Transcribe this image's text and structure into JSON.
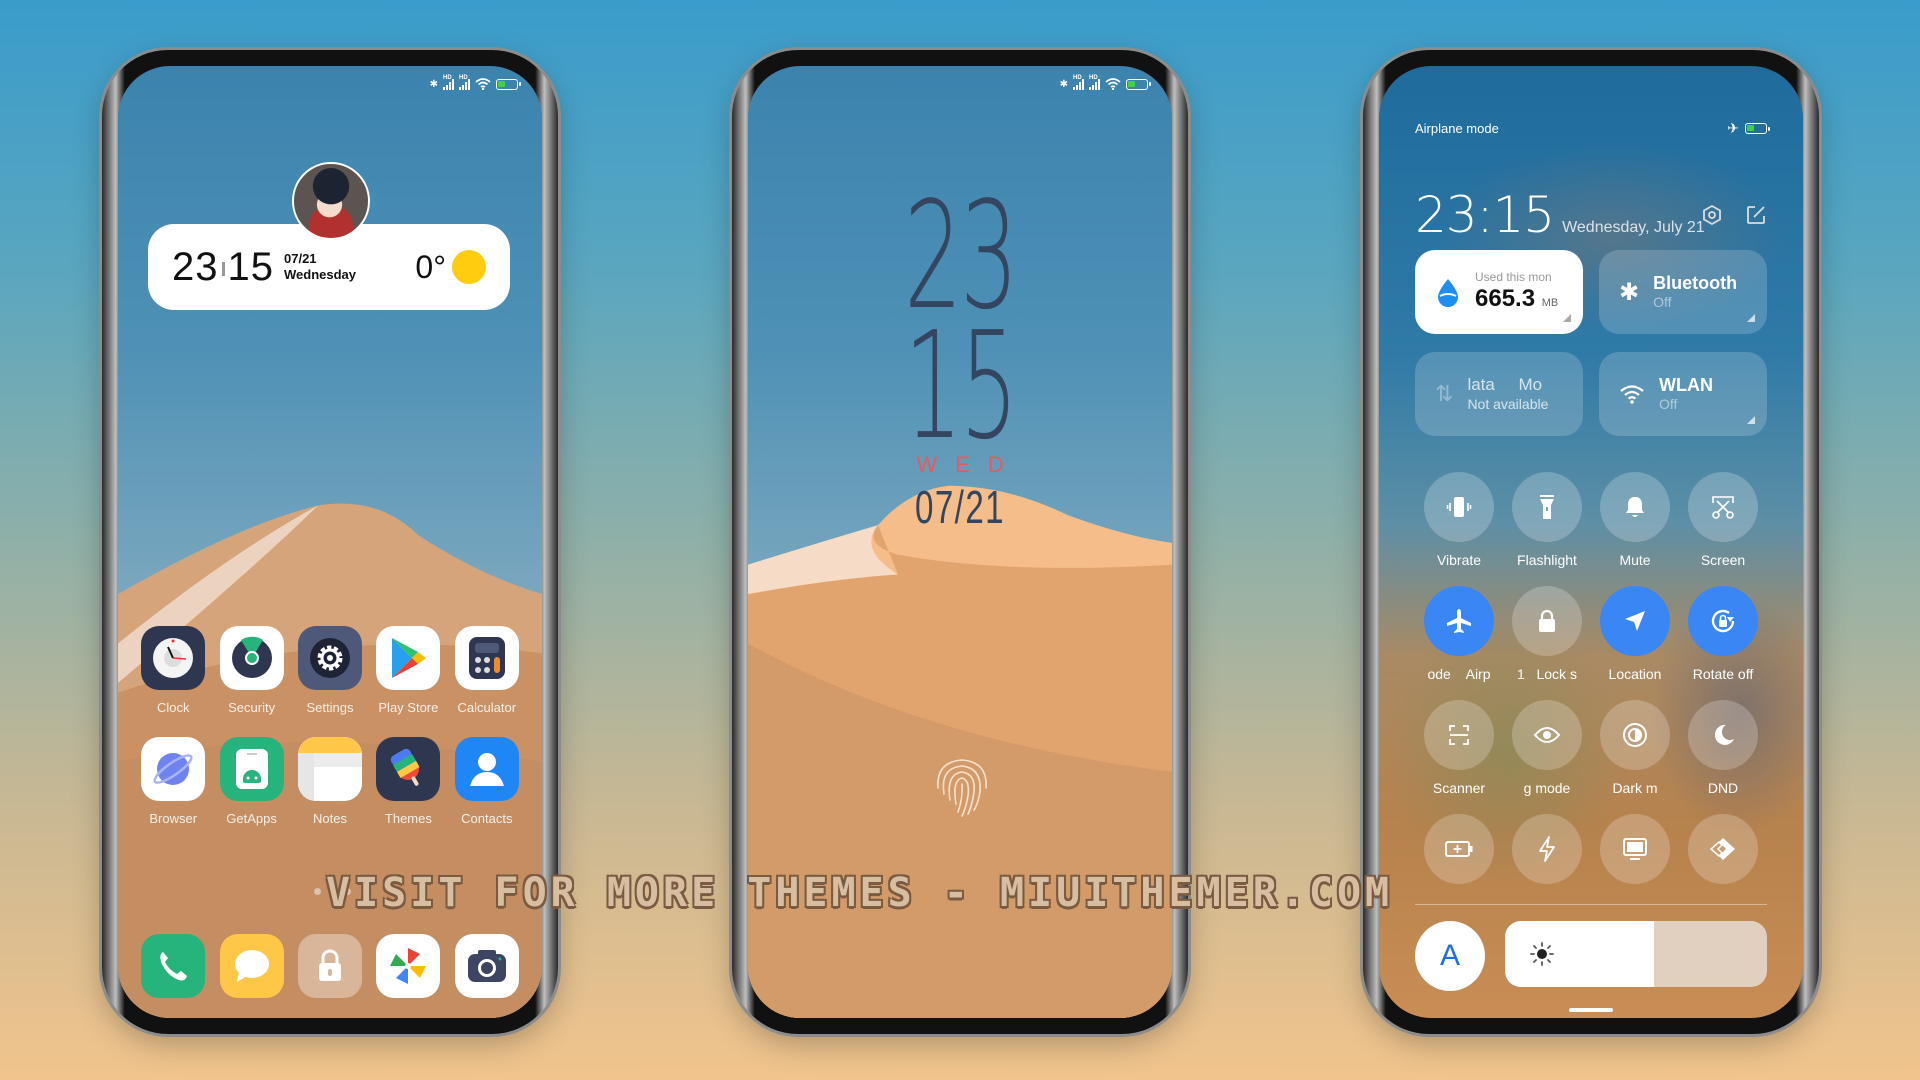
{
  "left_phone": {
    "status_icons": [
      "bluetooth-icon",
      "signal-hd-icon",
      "signal-hd-icon",
      "wifi-icon",
      "battery-charging-icon"
    ],
    "widget": {
      "hour": "23",
      "minute": "15",
      "date": "07/21",
      "weekday": "Wednesday",
      "temperature": "0°",
      "weather": "sunny"
    },
    "apps": [
      {
        "label": "Clock",
        "icon": "clock-icon",
        "bg": "#2e3650"
      },
      {
        "label": "Security",
        "icon": "security-radar-icon",
        "bg": "#ffffff"
      },
      {
        "label": "Settings",
        "icon": "gear-icon",
        "bg": "#4e5878"
      },
      {
        "label": "Play Store",
        "icon": "play-store-icon",
        "bg": "#ffffff"
      },
      {
        "label": "Calculator",
        "icon": "calculator-icon",
        "bg": "#ffffff"
      },
      {
        "label": "Browser",
        "icon": "planet-icon",
        "bg": "#ffffff"
      },
      {
        "label": "GetApps",
        "icon": "android-store-icon",
        "bg": "#27b37c"
      },
      {
        "label": "Notes",
        "icon": "notes-icon",
        "bg": "#ffffff"
      },
      {
        "label": "Themes",
        "icon": "popsicle-icon",
        "bg": "#2e3650"
      },
      {
        "label": "Contacts",
        "icon": "contact-person-icon",
        "bg": "#1e86f5"
      }
    ],
    "page_dots": {
      "count": 3,
      "active": 1
    },
    "dock": [
      {
        "icon": "phone-icon",
        "bg": "#27b37c"
      },
      {
        "icon": "message-icon",
        "bg": "#fec748"
      },
      {
        "icon": "lock-icon",
        "bg": "#d9b69a"
      },
      {
        "icon": "pinwheel-gallery-icon",
        "bg": "#ffffff"
      },
      {
        "icon": "camera-icon",
        "bg": "#ffffff"
      }
    ]
  },
  "middle_phone": {
    "status_icons": [
      "bluetooth-icon",
      "signal-hd-icon",
      "signal-hd-icon",
      "wifi-icon",
      "battery-charging-icon"
    ],
    "hour": "23",
    "minute": "15",
    "day": "WED",
    "date": "07/21",
    "fingerprint_icon": "fingerprint-icon"
  },
  "right_phone": {
    "status_label": "Airplane mode",
    "status_icons": [
      "airplane-icon",
      "battery-charging-icon"
    ],
    "time": "23:15",
    "date": "Wednesday, July 21",
    "actions": [
      "settings-hex-icon",
      "edit-icon"
    ],
    "tiles": [
      {
        "title": "Used this mon",
        "value": "665.3",
        "unit": "MB",
        "icon": "water-drop-icon",
        "active": true
      },
      {
        "title": "Bluetooth",
        "sub": "Off",
        "icon": "bluetooth-icon",
        "active": false
      },
      {
        "title": "lata     Mo",
        "sub": "Not available",
        "icon": "mobile-data-icon",
        "active": false
      },
      {
        "title": "WLAN",
        "sub": "Off",
        "icon": "wifi-icon",
        "active": false
      }
    ],
    "toggles": [
      {
        "label": "Vibrate",
        "icon": "vibrate-icon",
        "on": false
      },
      {
        "label": "Flashlight",
        "icon": "flashlight-icon",
        "on": false
      },
      {
        "label": "Mute",
        "icon": "bell-icon",
        "on": false
      },
      {
        "label": "Screen",
        "icon": "screenshot-scissors-icon",
        "on": false
      },
      {
        "label": "ode    Airp",
        "icon": "airplane-icon",
        "on": true
      },
      {
        "label": "1   Lock s",
        "icon": "lock-icon",
        "on": false
      },
      {
        "label": "Location",
        "icon": "location-arrow-icon",
        "on": true
      },
      {
        "label": "Rotate off",
        "icon": "rotate-lock-icon",
        "on": true
      },
      {
        "label": "Scanner",
        "icon": "scanner-icon",
        "on": false
      },
      {
        "label": "g mode",
        "icon": "eye-icon",
        "on": false
      },
      {
        "label": "Dark m",
        "icon": "dark-mode-icon",
        "on": false
      },
      {
        "label": "DND",
        "icon": "moon-icon",
        "on": false
      },
      {
        "label": "",
        "icon": "battery-saver-icon",
        "on": false
      },
      {
        "label": "",
        "icon": "lightning-icon",
        "on": false
      },
      {
        "label": "",
        "icon": "cast-screen-icon",
        "on": false
      },
      {
        "label": "",
        "icon": "nearby-share-icon",
        "on": false
      }
    ],
    "auto_brightness_label": "A",
    "brightness": 0.57
  },
  "watermark": "VISIT FOR MORE THEMES - MIUITHEMER.COM"
}
